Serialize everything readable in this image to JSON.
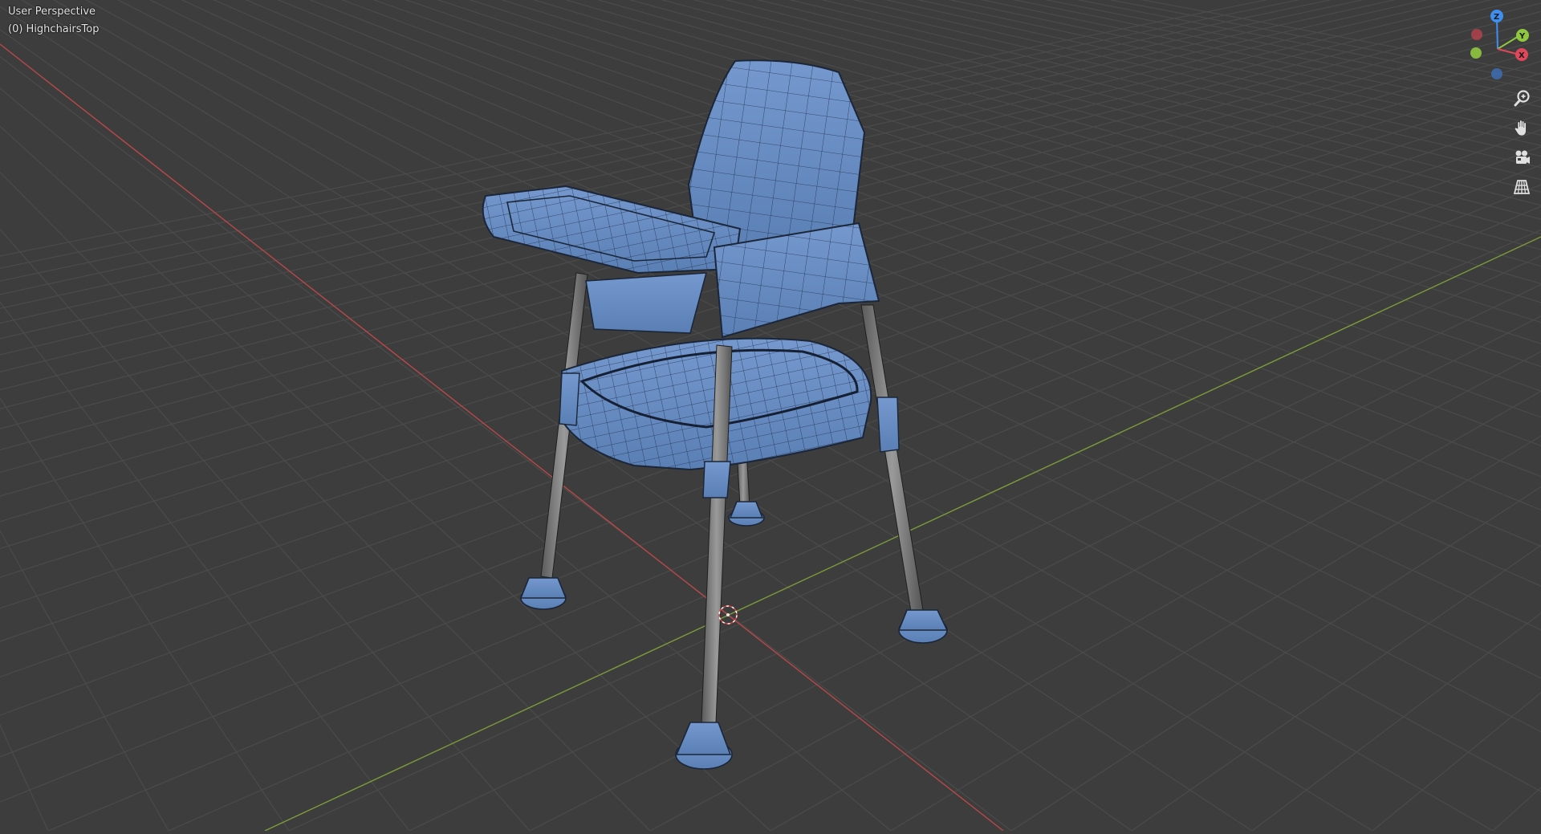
{
  "viewport": {
    "view_name": "User Perspective",
    "active_object": "(0) HighchairsTop"
  },
  "gizmo": {
    "x_label": "X",
    "y_label": "Y",
    "z_label": "Z",
    "x_color": "#e0475b",
    "y_color": "#8fc73e",
    "z_color": "#3d8ff0"
  },
  "navigation": {
    "zoom_icon": "zoom-icon",
    "pan_icon": "hand-pan-icon",
    "camera_icon": "camera-view-icon",
    "ortho_icon": "perspective-grid-icon"
  },
  "colors": {
    "background": "#3d3d3d",
    "grid": "#4a4a4a",
    "x_axis_line": "#c44a4a",
    "y_axis_line": "#7fa33a",
    "mesh_fill": "#6a8fc4",
    "mesh_wire": "#1e2a3d",
    "leg_fill": "#7a7a7a"
  }
}
